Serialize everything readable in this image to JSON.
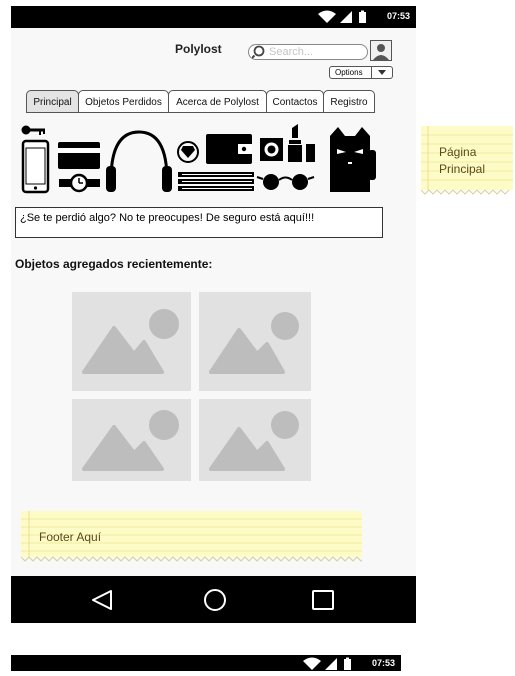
{
  "status_bar": {
    "time": "07:53"
  },
  "app": {
    "title": "Polylost",
    "search_placeholder": "Search...",
    "options_label": "Options"
  },
  "tabs": [
    {
      "label": "Principal",
      "active": true
    },
    {
      "label": "Objetos Perdidos"
    },
    {
      "label": "Acerca de Polylost"
    },
    {
      "label": "Contactos"
    },
    {
      "label": "Registro"
    }
  ],
  "hero_icons": [
    "key-icon",
    "smartphone-icon",
    "credit-card-icon",
    "watch-icon",
    "headphones-icon",
    "diamond-ring-icon",
    "wallet-icon",
    "books-icon",
    "condom-icon",
    "lipstick-icon",
    "sunglasses-icon",
    "lucky-cat-icon"
  ],
  "message": "¿Se te perdió algo?  No te preocupes!  De seguro está aquí!!!",
  "recent": {
    "title": "Objetos agregados recientemente:",
    "thumbnails": [
      "image-placeholder",
      "image-placeholder",
      "image-placeholder",
      "image-placeholder"
    ]
  },
  "footer_note": "Footer Aquí",
  "side_note": {
    "line1": "Página",
    "line2": "Principal"
  },
  "colors": {
    "note_background": "#fefcc6",
    "active_tab": "#e4e4e4",
    "placeholder": "#e1e1e1"
  }
}
